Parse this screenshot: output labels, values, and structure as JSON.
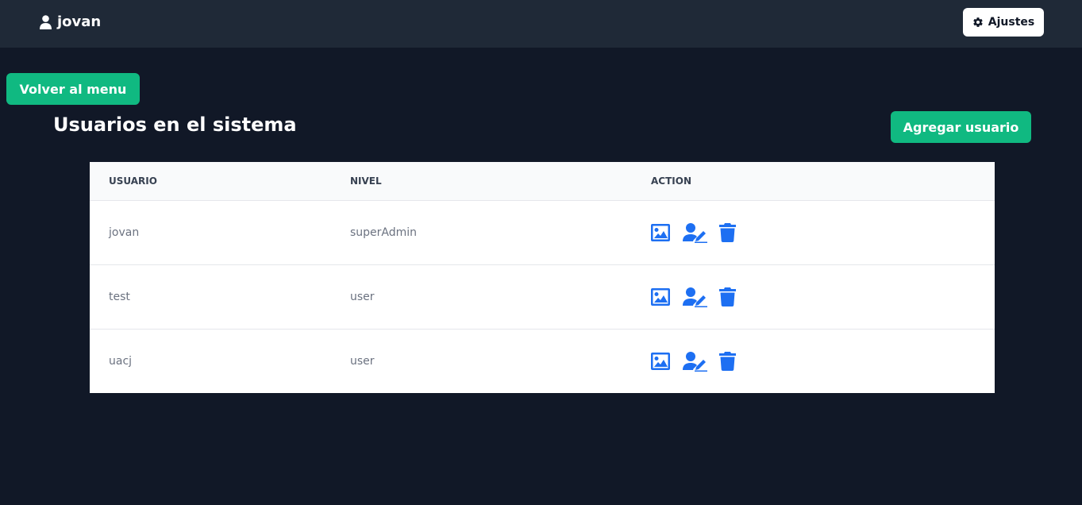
{
  "header": {
    "user_icon": "user-icon",
    "username": "jovan",
    "settings_label": "Ajustes",
    "settings_icon": "gear-icon"
  },
  "buttons": {
    "back_label": "Volver al menu",
    "add_label": "Agregar usuario"
  },
  "page": {
    "title": "Usuarios en el sistema"
  },
  "table": {
    "columns": [
      "USUARIO",
      "NIVEL",
      "ACTION"
    ],
    "rows": [
      {
        "usuario": "jovan",
        "nivel": "superAdmin"
      },
      {
        "usuario": "test",
        "nivel": "user"
      },
      {
        "usuario": "uacj",
        "nivel": "user"
      }
    ],
    "action_icons": [
      "image-icon",
      "user-edit-icon",
      "trash-icon"
    ]
  },
  "colors": {
    "background": "#111827",
    "topbar": "#1f2937",
    "accent_green": "#10b981",
    "icon_blue": "#1d6ff2"
  }
}
